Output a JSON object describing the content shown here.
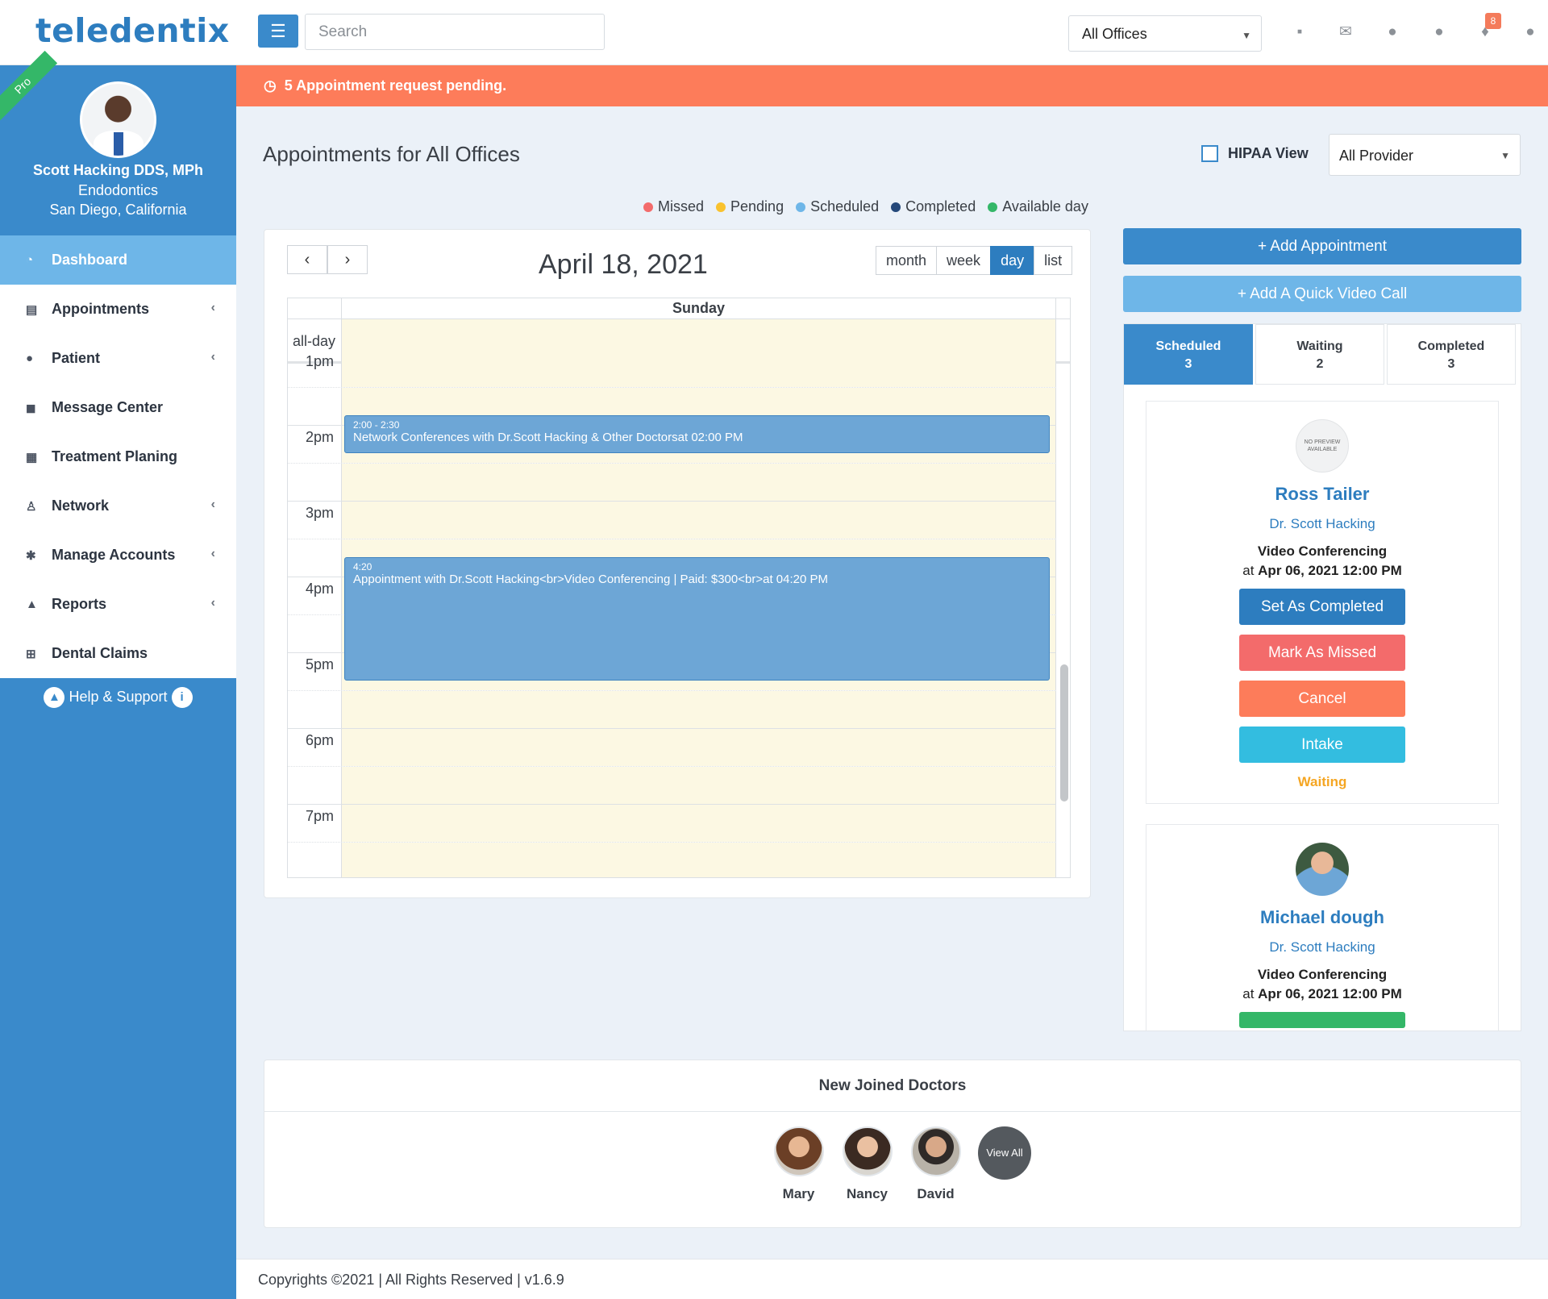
{
  "app": {
    "logo": "teledentix"
  },
  "topbar": {
    "search_placeholder": "Search",
    "office": "All Offices",
    "notification_count": "8",
    "icons": [
      "note-icon",
      "mail-icon",
      "chat-icon",
      "comments-icon",
      "bell-icon",
      "user-icon"
    ]
  },
  "profile": {
    "badge": "Pro",
    "name": "Scott Hacking DDS, MPh",
    "specialty": "Endodontics",
    "location": "San Diego, California"
  },
  "sidebar": {
    "items": [
      {
        "label": "Dashboard",
        "icon": "dashboard-icon",
        "active": true,
        "expandable": false
      },
      {
        "label": "Appointments",
        "icon": "appointments-icon",
        "active": false,
        "expandable": true
      },
      {
        "label": "Patient",
        "icon": "patient-icon",
        "active": false,
        "expandable": true
      },
      {
        "label": "Message Center",
        "icon": "message-icon",
        "active": false,
        "expandable": false
      },
      {
        "label": "Treatment Planing",
        "icon": "treatment-icon",
        "active": false,
        "expandable": false
      },
      {
        "label": "Network",
        "icon": "network-icon",
        "active": false,
        "expandable": true
      },
      {
        "label": "Manage Accounts",
        "icon": "gear-icon",
        "active": false,
        "expandable": true
      },
      {
        "label": "Reports",
        "icon": "chart-icon",
        "active": false,
        "expandable": true
      },
      {
        "label": "Dental Claims",
        "icon": "plus-square-icon",
        "active": false,
        "expandable": false
      }
    ],
    "help": "Help & Support"
  },
  "alert": {
    "text": "5 Appointment request pending."
  },
  "header": {
    "title": "Appointments for All Offices",
    "hipaa_label": "HIPAA View",
    "provider": "All Provider"
  },
  "legend": [
    {
      "label": "Missed",
      "color": "#f36b6b"
    },
    {
      "label": "Pending",
      "color": "#f9c22e"
    },
    {
      "label": "Scheduled",
      "color": "#6eb6e8"
    },
    {
      "label": "Completed",
      "color": "#24487a"
    },
    {
      "label": "Available day",
      "color": "#34b768"
    }
  ],
  "calendar": {
    "date": "April 18, 2021",
    "views": [
      "month",
      "week",
      "day",
      "list"
    ],
    "active_view": "day",
    "day_header": "Sunday",
    "allday_label": "all-day",
    "hours": [
      "1pm",
      "2pm",
      "3pm",
      "4pm",
      "5pm",
      "6pm",
      "7pm"
    ],
    "events": [
      {
        "time": "2:00 - 2:30",
        "title": "Network Conferences with Dr.Scott Hacking & Other Doctorsat 02:00 PM"
      },
      {
        "time": "4:20",
        "title": "Appointment with Dr.Scott Hacking<br>Video Conferencing | Paid: $300<br>at 04:20 PM"
      }
    ]
  },
  "actions": {
    "add_appointment": "+ Add Appointment",
    "add_video": "+ Add A Quick Video Call"
  },
  "status_tabs": [
    {
      "label": "Scheduled",
      "count": "3"
    },
    {
      "label": "Waiting",
      "count": "2"
    },
    {
      "label": "Completed",
      "count": "3"
    }
  ],
  "patients": [
    {
      "name": "Ross Tailer",
      "doctor": "Dr. Scott Hacking",
      "type": "Video Conferencing",
      "at_prefix": "at",
      "at": "Apr 06, 2021 12:00 PM",
      "no_preview": [
        "NO PREVIEW",
        "AVAILABLE"
      ],
      "buttons": [
        {
          "label": "Set As Completed",
          "color": "#2d7dbf"
        },
        {
          "label": "Mark As Missed",
          "color": "#f36b6b"
        },
        {
          "label": "Cancel",
          "color": "#fd7c5a"
        },
        {
          "label": "Intake",
          "color": "#33bde0"
        }
      ],
      "status": "Waiting"
    },
    {
      "name": "Michael dough",
      "doctor": "Dr. Scott Hacking",
      "type": "Video Conferencing",
      "at_prefix": "at",
      "at": "Apr 06, 2021 12:00 PM",
      "button_color": "#34b768"
    }
  ],
  "doctors": {
    "title": "New Joined Doctors",
    "list": [
      "Mary",
      "Nancy",
      "David"
    ],
    "view_all": "View All"
  },
  "footer": {
    "text": "Copyrights ©2021 | All Rights Reserved | v1.6.9"
  }
}
